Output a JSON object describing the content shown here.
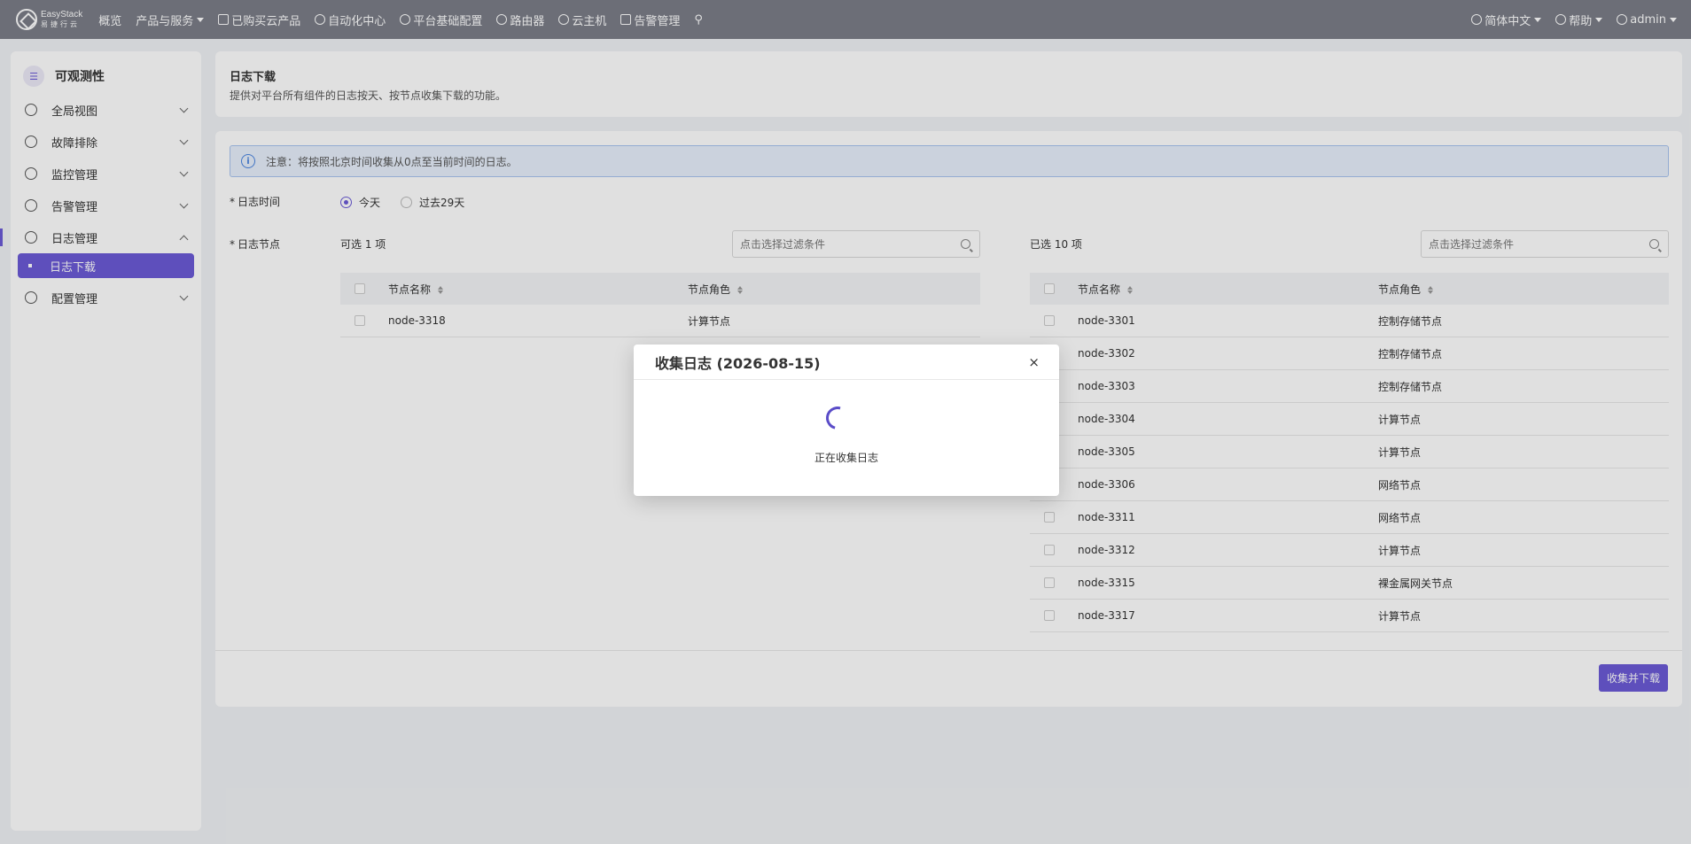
{
  "topnav": {
    "logo": {
      "line1": "EasyStack",
      "line2": "易捷行云"
    },
    "items": [
      {
        "label": "概览"
      },
      {
        "label": "产品与服务"
      },
      {
        "label": "已购买云产品"
      },
      {
        "label": "自动化中心"
      },
      {
        "label": "平台基础配置"
      },
      {
        "label": "路由器"
      },
      {
        "label": "云主机"
      },
      {
        "label": "告警管理"
      }
    ],
    "language": "简体中文",
    "help": "帮助",
    "user": "admin"
  },
  "sidebar": {
    "title": "可观测性",
    "items": [
      {
        "label": "全局视图"
      },
      {
        "label": "故障排除"
      },
      {
        "label": "监控管理"
      },
      {
        "label": "告警管理"
      },
      {
        "label": "日志管理"
      },
      {
        "label": "配置管理"
      }
    ],
    "active_sub": "日志下载"
  },
  "header": {
    "title": "日志下载",
    "desc": "提供对平台所有组件的日志按天、按节点收集下载的功能。"
  },
  "notice": "注意：将按照北京时间收集从0点至当前时间的日志。",
  "form": {
    "time_label": "日志时间",
    "time_options": [
      "今天",
      "过去29天"
    ],
    "time_selected": "今天",
    "node_label": "日志节点"
  },
  "left_list": {
    "title": "可选 1 项",
    "search_placeholder": "点击选择过滤条件",
    "col_name": "节点名称",
    "col_role": "节点角色",
    "rows": [
      {
        "name": "node-3318",
        "role": "计算节点"
      }
    ]
  },
  "right_list": {
    "title": "已选 10 项",
    "search_placeholder": "点击选择过滤条件",
    "col_name": "节点名称",
    "col_role": "节点角色",
    "rows": [
      {
        "name": "node-3301",
        "role": "控制存储节点"
      },
      {
        "name": "node-3302",
        "role": "控制存储节点"
      },
      {
        "name": "node-3303",
        "role": "控制存储节点"
      },
      {
        "name": "node-3304",
        "role": "计算节点"
      },
      {
        "name": "node-3305",
        "role": "计算节点"
      },
      {
        "name": "node-3306",
        "role": "网络节点"
      },
      {
        "name": "node-3311",
        "role": "网络节点"
      },
      {
        "name": "node-3312",
        "role": "计算节点"
      },
      {
        "name": "node-3315",
        "role": "裸金属网关节点"
      },
      {
        "name": "node-3317",
        "role": "计算节点"
      }
    ]
  },
  "submit_label": "收集并下载",
  "modal": {
    "title": "收集日志 (2026-08-15)",
    "close": "×",
    "message": "正在收集日志"
  },
  "colors": {
    "accent": "#6b5bd6",
    "nav_bg": "#7b7e88"
  }
}
